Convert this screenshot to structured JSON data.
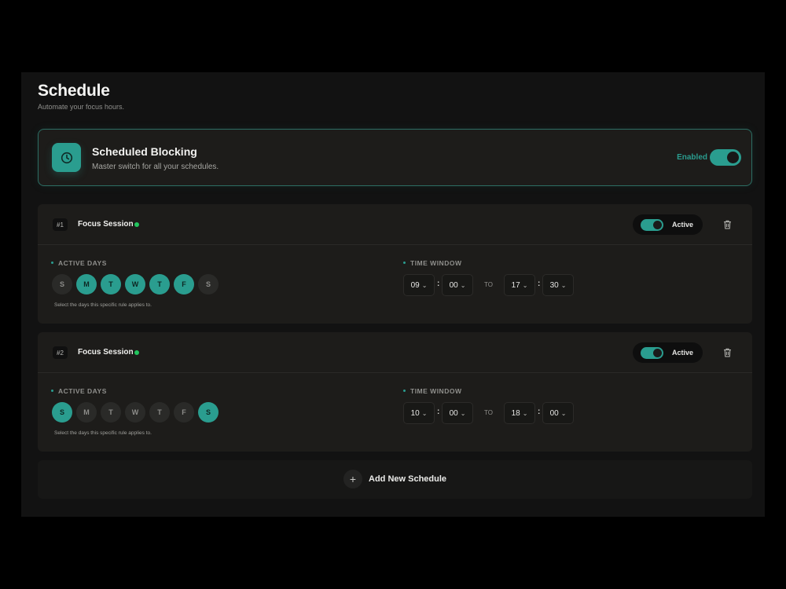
{
  "header": {
    "title": "Schedule",
    "subtitle": "Automate your focus hours."
  },
  "master": {
    "title": "Scheduled Blocking",
    "description": "Master switch for all your schedules.",
    "status_label": "Enabled",
    "icon": "clock-icon",
    "enabled": true
  },
  "labels": {
    "active_days": "ACTIVE DAYS",
    "time_window": "TIME WINDOW",
    "days_hint": "Select the days this specific rule applies to.",
    "to": "TO",
    "active": "Active",
    "separator": ":"
  },
  "schedules": [
    {
      "number": "#1",
      "name": "Focus Session",
      "active": true,
      "days": [
        {
          "label": "S",
          "on": false
        },
        {
          "label": "M",
          "on": true
        },
        {
          "label": "T",
          "on": true
        },
        {
          "label": "W",
          "on": true
        },
        {
          "label": "T",
          "on": true
        },
        {
          "label": "F",
          "on": true
        },
        {
          "label": "S",
          "on": false
        }
      ],
      "start_hour": "09",
      "start_minute": "00",
      "end_hour": "17",
      "end_minute": "30"
    },
    {
      "number": "#2",
      "name": "Focus Session",
      "active": true,
      "days": [
        {
          "label": "S",
          "on": true
        },
        {
          "label": "M",
          "on": false
        },
        {
          "label": "T",
          "on": false
        },
        {
          "label": "W",
          "on": false
        },
        {
          "label": "T",
          "on": false
        },
        {
          "label": "F",
          "on": false
        },
        {
          "label": "S",
          "on": true
        }
      ],
      "start_hour": "10",
      "start_minute": "00",
      "end_hour": "18",
      "end_minute": "00"
    }
  ],
  "add_new": {
    "label": "Add New Schedule",
    "icon": "plus-icon"
  },
  "colors": {
    "accent": "#2a9d8f",
    "status_dot": "#22c55e",
    "background": "#121212",
    "card": "#1d1c1a"
  }
}
